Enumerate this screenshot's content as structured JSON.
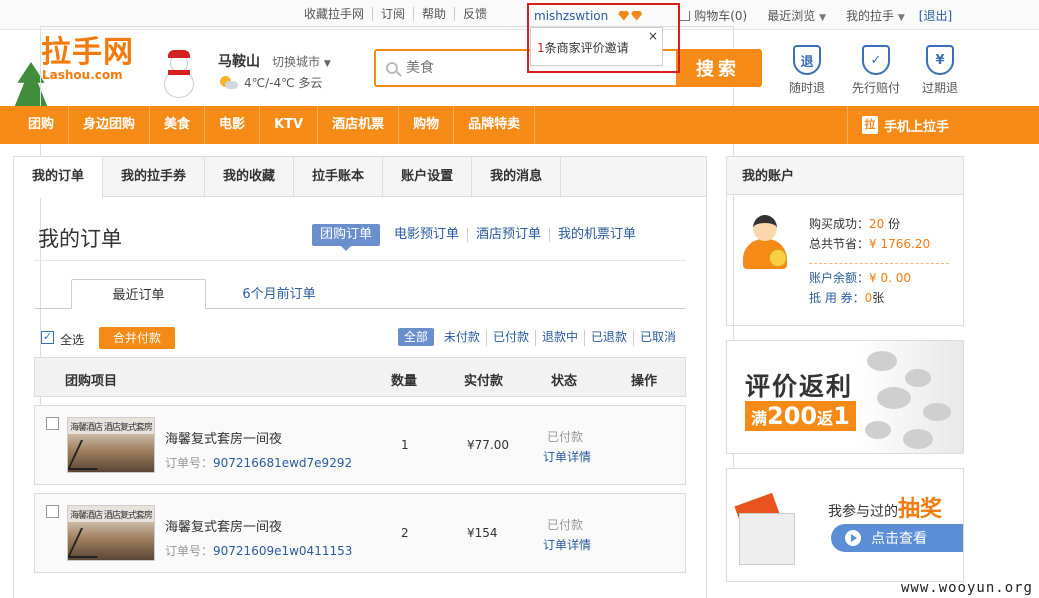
{
  "topbar": {
    "links": [
      "收藏拉手网",
      "订阅",
      "帮助",
      "反馈"
    ],
    "username": "mishzswtion",
    "cart_label": "购物车(0)",
    "recent_label": "最近浏览",
    "my_label": "我的拉手",
    "logout_label": "[退出]"
  },
  "notification": {
    "count": "1",
    "text": "条商家评价邀请",
    "close": "×"
  },
  "logo": {
    "main": "拉手网",
    "sub": "Lashou.com"
  },
  "city": {
    "name": "马鞍山",
    "switch_label": "切换城市",
    "weather": "4℃/-4℃ 多云"
  },
  "search": {
    "placeholder": "美食",
    "button": "搜索"
  },
  "guarantees": [
    {
      "icon": "退",
      "label": "随时退"
    },
    {
      "icon": "✓",
      "label": "先行赔付"
    },
    {
      "icon": "¥",
      "label": "过期退"
    }
  ],
  "nav": {
    "items": [
      "团购",
      "身边团购",
      "美食",
      "电影",
      "KTV",
      "酒店机票",
      "购物",
      "品牌特卖"
    ],
    "mobile": "手机上拉手",
    "mobile_icon": "拉"
  },
  "tabs": [
    "我的订单",
    "我的拉手券",
    "我的收藏",
    "拉手账本",
    "账户设置",
    "我的消息"
  ],
  "page_title": "我的订单",
  "subtabs": [
    "团购订单",
    "电影预订单",
    "酒店预订单",
    "我的机票订单"
  ],
  "order_tabs": [
    "最近订单",
    "6个月前订单"
  ],
  "toolbar": {
    "select_all": "全选",
    "merge_pay": "合并付款",
    "filters": [
      "全部",
      "未付款",
      "已付款",
      "退款中",
      "已退款",
      "已取消"
    ]
  },
  "table_headers": [
    "团购项目",
    "数量",
    "实付款",
    "状态",
    "操作"
  ],
  "orders": [
    {
      "thumb_text": "海馨酒店 酒店复式套房",
      "title": "海馨复式套房一间夜",
      "order_label": "订单号：",
      "order_no": "907216681ewd7e9292",
      "qty": "1",
      "price": "¥77.00",
      "status": "已付款",
      "detail": "订单详情"
    },
    {
      "thumb_text": "海馨酒店 酒店复式套房",
      "title": "海馨复式套房一间夜",
      "order_label": "订单号：",
      "order_no": "90721609e1w0411153",
      "qty": "2",
      "price": "¥154",
      "status": "已付款",
      "detail": "订单详情"
    }
  ],
  "account": {
    "title": "我的账户",
    "buy_label": "购买成功：",
    "buy_value": "20",
    "buy_unit": " 份",
    "save_label": "总共节省：",
    "save_value": "¥ 1766.20",
    "balance_label": "账户余额：",
    "balance_value": "¥ 0. 00",
    "voucher_label": "抵 用 券：",
    "voucher_value": "0",
    "voucher_unit": "张"
  },
  "banner_review": {
    "title": "评价返利",
    "pre": "满",
    "amount1": "200",
    "mid": "返",
    "amount2": "1"
  },
  "banner_lottery": {
    "text": "我参与过的",
    "highlight": "抽奖",
    "cta": "点击查看"
  },
  "watermark": "www.wooyun.org",
  "colors": {
    "brand_orange": "#f58a16",
    "link_blue": "#2b5a9e",
    "highlight_red": "#d42020"
  }
}
